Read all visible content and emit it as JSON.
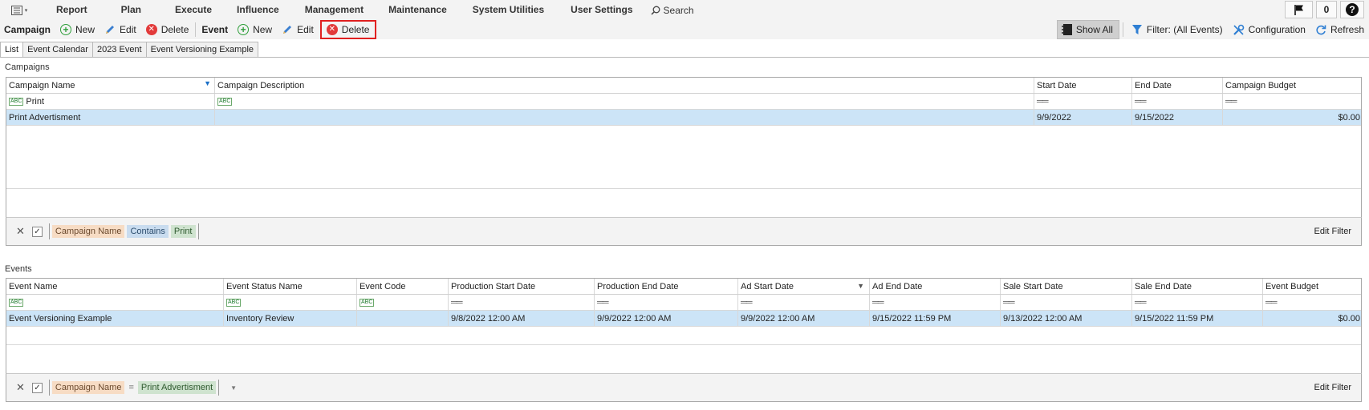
{
  "menubar": {
    "items": [
      "Report",
      "Plan",
      "Execute",
      "Influence",
      "Management",
      "Maintenance",
      "System Utilities",
      "User Settings"
    ],
    "search_label": "Search",
    "notification_count": "0",
    "help_label": "?"
  },
  "toolbar": {
    "campaign_label": "Campaign",
    "campaign_new": "New",
    "campaign_edit": "Edit",
    "campaign_delete": "Delete",
    "event_label": "Event",
    "event_new": "New",
    "event_edit": "Edit",
    "event_delete": "Delete",
    "show_all": "Show All",
    "filter": "Filter: (All Events)",
    "configuration": "Configuration",
    "refresh": "Refresh"
  },
  "tabs": [
    "List",
    "Event Calendar",
    "2023 Event",
    "Event Versioning Example"
  ],
  "campaigns": {
    "title": "Campaigns",
    "columns": [
      "Campaign Name",
      "Campaign Description",
      "Start Date",
      "End Date",
      "Campaign Budget"
    ],
    "filter_row": [
      "Print",
      "",
      "",
      "",
      ""
    ],
    "rows": [
      [
        "Print Advertisment",
        "",
        "9/9/2022",
        "9/15/2022",
        "$0.00"
      ]
    ],
    "filter_panel": {
      "field": "Campaign Name",
      "operator": "Contains",
      "value": "Print",
      "edit_label": "Edit Filter"
    }
  },
  "events": {
    "title": "Events",
    "columns": [
      "Event Name",
      "Event Status Name",
      "Event Code",
      "Production Start Date",
      "Production End Date",
      "Ad Start Date",
      "Ad End Date",
      "Sale Start Date",
      "Sale End Date",
      "Event Budget"
    ],
    "rows": [
      [
        "Event Versioning Example",
        "Inventory Review",
        "",
        "9/8/2022 12:00 AM",
        "9/9/2022 12:00 AM",
        "9/9/2022 12:00 AM",
        "9/15/2022 11:59 PM",
        "9/13/2022 12:00 AM",
        "9/15/2022 11:59 PM",
        "$0.00"
      ]
    ],
    "filter_panel": {
      "field": "Campaign Name",
      "operator": "=",
      "value": "Print Advertisment",
      "edit_label": "Edit Filter"
    }
  }
}
